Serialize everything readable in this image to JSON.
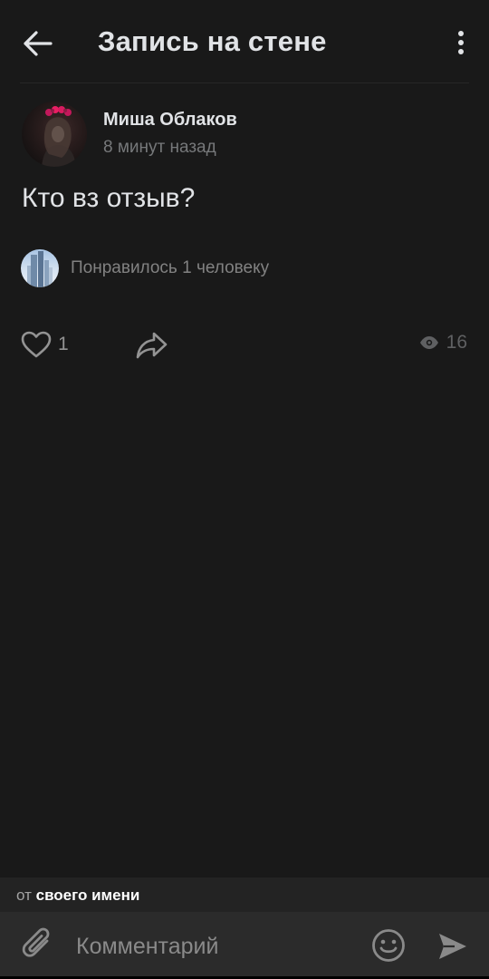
{
  "header": {
    "title": "Запись на стене",
    "back_icon": "arrow-left-icon",
    "menu_icon": "more-vertical-icon"
  },
  "post": {
    "author_name": "Миша Облаков",
    "time": "8 минут назад",
    "text": "Кто вз отзыв?",
    "likes_summary": "Понравилось 1 человеку"
  },
  "actions": {
    "like_count": "1",
    "views_count": "16",
    "like_icon": "heart-icon",
    "share_icon": "share-icon",
    "views_icon": "eye-icon"
  },
  "composer": {
    "author_prefix": "от",
    "author_name": "своего имени",
    "placeholder": "Комментарий",
    "attach_icon": "paperclip-icon",
    "emoji_icon": "smiley-icon",
    "send_icon": "send-icon"
  },
  "colors": {
    "background": "#191919",
    "text_primary": "#e1e3e6",
    "text_secondary": "#76787a",
    "composer_bg": "#2b2b2b"
  }
}
